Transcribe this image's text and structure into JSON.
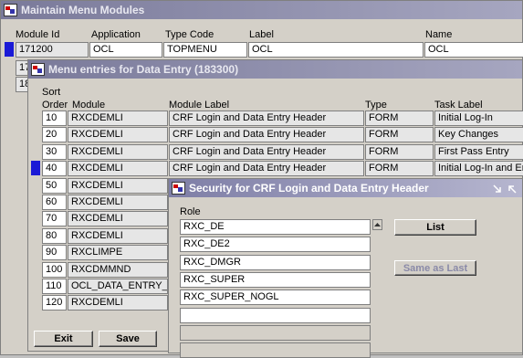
{
  "main_window": {
    "title": "Maintain Menu Modules",
    "headers": {
      "module_id": "Module Id",
      "application": "Application",
      "type_code": "Type Code",
      "label": "Label",
      "name": "Name"
    },
    "row": {
      "module_id": "171200",
      "application": "OCL",
      "type_code": "TOPMENU",
      "label": "OCL",
      "name": "OCL"
    },
    "behind_rows": [
      "17",
      "18"
    ]
  },
  "menu_window": {
    "title": "Menu entries for Data Entry (183300)",
    "headers": {
      "sort_top": "Sort",
      "sort_bottom": "Order",
      "module": "Module",
      "module_label": "Module Label",
      "type": "Type",
      "task_label": "Task Label"
    },
    "rows": [
      {
        "order": "10",
        "module": "RXCDEMLI",
        "label": "CRF Login and Data Entry Header",
        "type": "FORM",
        "task": "Initial Log-In"
      },
      {
        "order": "20",
        "module": "RXCDEMLI",
        "label": "CRF Login and Data Entry Header",
        "type": "FORM",
        "task": "Key Changes"
      },
      {
        "order": "30",
        "module": "RXCDEMLI",
        "label": "CRF Login and Data Entry Header",
        "type": "FORM",
        "task": "First Pass Entry"
      },
      {
        "order": "40",
        "module": "RXCDEMLI",
        "label": "CRF Login and Data Entry Header",
        "type": "FORM",
        "task": "Initial Log-In and En"
      },
      {
        "order": "50",
        "module": "RXCDEMLI",
        "label": "",
        "type": "",
        "task": ""
      },
      {
        "order": "60",
        "module": "RXCDEMLI",
        "label": "",
        "type": "",
        "task": ""
      },
      {
        "order": "70",
        "module": "RXCDEMLI",
        "label": "",
        "type": "",
        "task": ""
      },
      {
        "order": "80",
        "module": "RXCDEMLI",
        "label": "",
        "type": "",
        "task": ""
      },
      {
        "order": "90",
        "module": "RXCLIMPE",
        "label": "",
        "type": "",
        "task": ""
      },
      {
        "order": "100",
        "module": "RXCDMMND",
        "label": "",
        "type": "",
        "task": ""
      },
      {
        "order": "110",
        "module": "OCL_DATA_ENTRY_R",
        "label": "",
        "type": "",
        "task": ""
      },
      {
        "order": "120",
        "module": "RXCDEMLI",
        "label": "",
        "type": "",
        "task": ""
      }
    ],
    "exit_label": "Exit",
    "save_label": "Save"
  },
  "security_window": {
    "title": "Security for CRF Login and Data Entry Header",
    "role_header": "Role",
    "roles": [
      "RXC_DE",
      "RXC_DE2",
      "RXC_DMGR",
      "RXC_SUPER",
      "RXC_SUPER_NOGL",
      "",
      "",
      ""
    ],
    "list_label": "List",
    "same_as_last_label": "Same as Last",
    "icons": [
      "app-icon",
      "minimize-icon",
      "maximize-icon",
      "scroll-up-icon"
    ]
  },
  "colors": {
    "current_record": "#1a1ad6",
    "title_bar": "#8a8ab0",
    "window_bg": "#d4d0c8"
  }
}
